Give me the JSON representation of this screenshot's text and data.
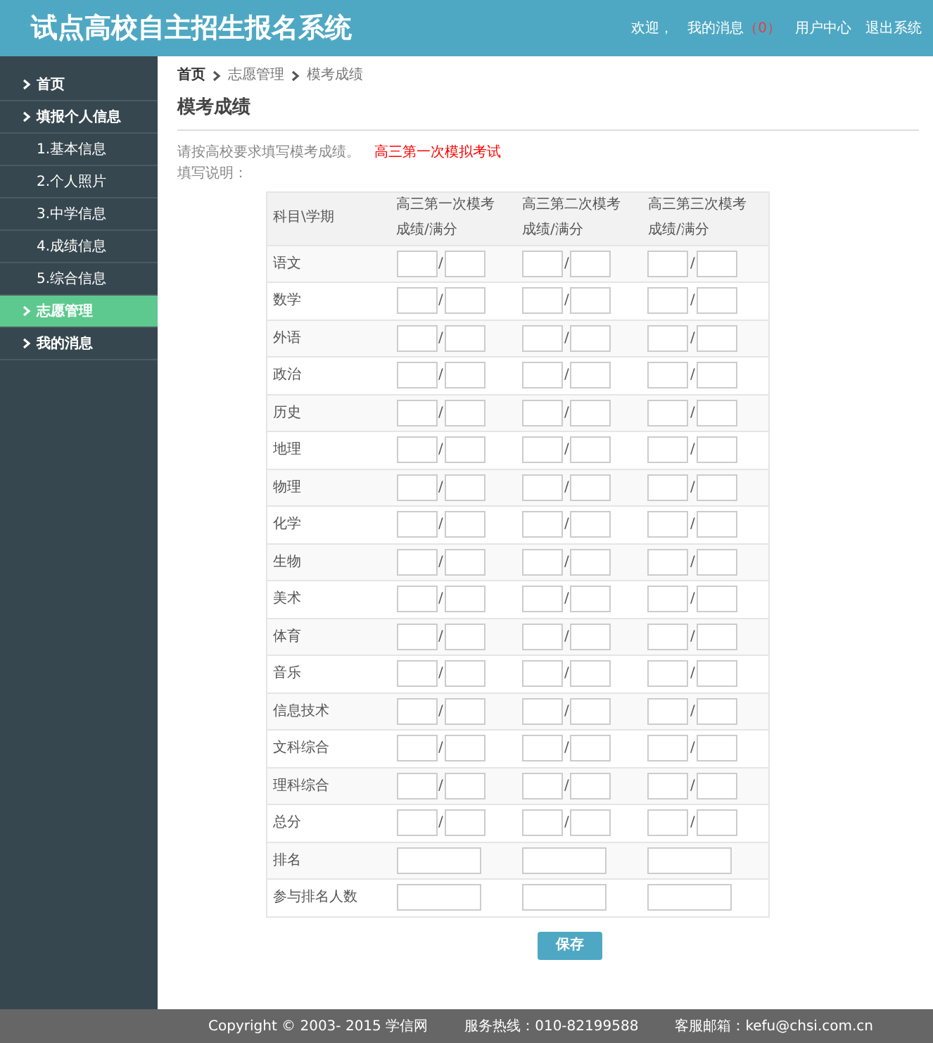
{
  "header": {
    "title": "试点高校自主招生报名系统",
    "welcome": "欢迎，",
    "messages": {
      "label": "我的消息",
      "count": "（0）"
    },
    "links": [
      "用户中心",
      "退出系统"
    ]
  },
  "sidebar": {
    "items": [
      {
        "label": "首页",
        "selected": false
      },
      {
        "label": "填报个人信息",
        "selected": false,
        "children": [
          {
            "label": "1.基本信息",
            "selected": false
          },
          {
            "label": "2.个人照片",
            "selected": false
          },
          {
            "label": "3.中学信息",
            "selected": false
          },
          {
            "label": "4.成绩信息",
            "selected": false
          },
          {
            "label": "5.综合信息",
            "selected": false
          }
        ]
      },
      {
        "label": "志愿管理",
        "selected": true
      },
      {
        "label": "我的消息",
        "selected": false
      }
    ]
  },
  "breadcrumb": [
    "首页",
    "志愿管理",
    "模考成绩"
  ],
  "page_title": "模考成绩",
  "instructions": {
    "text": "请按高校要求填写模考成绩。",
    "highlight": "高三第一次模拟考试",
    "note": "填写说明："
  },
  "table": {
    "corner": "科目\\学期",
    "columns": [
      {
        "name": "高三第一次模考",
        "unit": "成绩/满分"
      },
      {
        "name": "高三第二次模考",
        "unit": "成绩/满分"
      },
      {
        "name": "高三第三次模考",
        "unit": "成绩/满分"
      }
    ],
    "separator": "/",
    "rows": [
      {
        "subject": "语文",
        "kind": "pair"
      },
      {
        "subject": "数学",
        "kind": "pair"
      },
      {
        "subject": "外语",
        "kind": "pair"
      },
      {
        "subject": "政治",
        "kind": "pair"
      },
      {
        "subject": "历史",
        "kind": "pair"
      },
      {
        "subject": "地理",
        "kind": "pair"
      },
      {
        "subject": "物理",
        "kind": "pair"
      },
      {
        "subject": "化学",
        "kind": "pair"
      },
      {
        "subject": "生物",
        "kind": "pair"
      },
      {
        "subject": "美术",
        "kind": "pair"
      },
      {
        "subject": "体育",
        "kind": "pair"
      },
      {
        "subject": "音乐",
        "kind": "pair"
      },
      {
        "subject": "信息技术",
        "kind": "pair"
      },
      {
        "subject": "文科综合",
        "kind": "pair"
      },
      {
        "subject": "理科综合",
        "kind": "pair"
      },
      {
        "subject": "总分",
        "kind": "pair"
      },
      {
        "subject": "排名",
        "kind": "single"
      },
      {
        "subject": "参与排名人数",
        "kind": "single"
      }
    ]
  },
  "save_button": "保存",
  "footer": [
    "Copyright © 2003- 2015 学信网",
    "服务热线：010-82199588",
    "客服邮箱：kefu@chsi.com.cn"
  ]
}
